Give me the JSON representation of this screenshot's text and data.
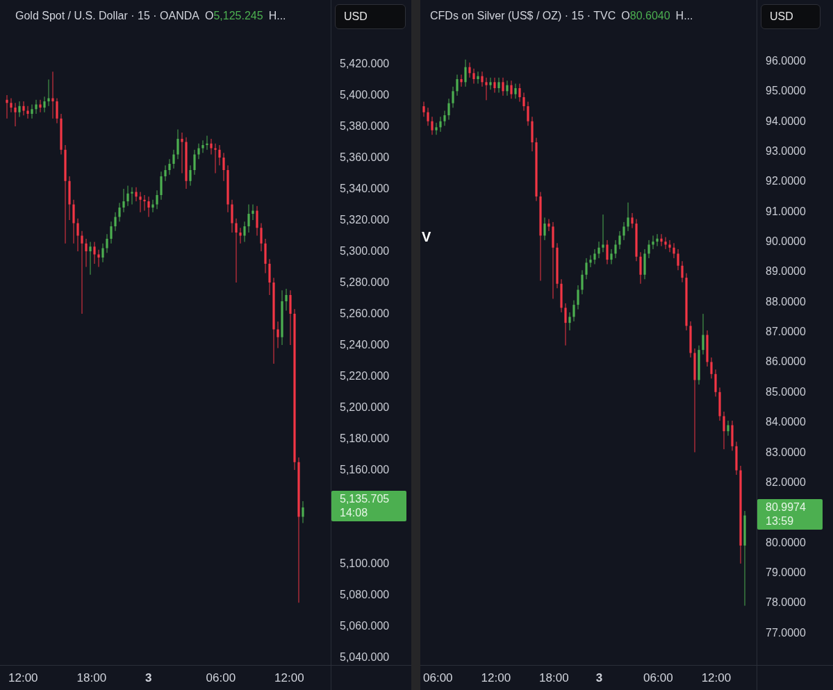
{
  "charts": [
    {
      "title": "Gold Spot / U.S. Dollar · 15 · OANDA",
      "open_label": "O",
      "open_value": "5,125.245",
      "more": "H...",
      "currency": "USD",
      "last_price": {
        "price": "5,135.705",
        "countdown": "14:08"
      },
      "time_labels": [
        {
          "kind": "time",
          "text": "12:00"
        },
        {
          "kind": "time",
          "text": "18:00"
        },
        {
          "kind": "day",
          "text": "3"
        },
        {
          "kind": "time",
          "text": "06:00"
        },
        {
          "kind": "time",
          "text": "12:00"
        }
      ],
      "chart_data": {
        "type": "candlestick",
        "categories": [
          null,
          null,
          null,
          null,
          null,
          null,
          null,
          null,
          null,
          null,
          null,
          null,
          null,
          null,
          null,
          null,
          null,
          null,
          null,
          null,
          null,
          null,
          null,
          null,
          null,
          null,
          null,
          null,
          null,
          null,
          null,
          null,
          null,
          null,
          null,
          null,
          null,
          null,
          null,
          null,
          null,
          null,
          null,
          null,
          null,
          null,
          null,
          null,
          null,
          null,
          null,
          null,
          null,
          null,
          null,
          null,
          null,
          null,
          null,
          null,
          null,
          null,
          null,
          null,
          null,
          null,
          null,
          null,
          null,
          null,
          null,
          null
        ],
        "ylim": [
          5035.1,
          5460.9
        ],
        "yticks": [
          {
            "value": 5420,
            "label": "5,420.000"
          },
          {
            "value": 5400,
            "label": "5,400.000"
          },
          {
            "value": 5380,
            "label": "5,380.000"
          },
          {
            "value": 5360,
            "label": "5,360.000"
          },
          {
            "value": 5340,
            "label": "5,340.000"
          },
          {
            "value": 5320,
            "label": "5,320.000"
          },
          {
            "value": 5300,
            "label": "5,300.000"
          },
          {
            "value": 5280,
            "label": "5,280.000"
          },
          {
            "value": 5260,
            "label": "5,260.000"
          },
          {
            "value": 5240,
            "label": "5,240.000"
          },
          {
            "value": 5220,
            "label": "5,220.000"
          },
          {
            "value": 5200,
            "label": "5,200.000"
          },
          {
            "value": 5180,
            "label": "5,180.000"
          },
          {
            "value": 5160,
            "label": "5,160.000"
          },
          {
            "value": 5100,
            "label": "5,100.000"
          },
          {
            "value": 5080,
            "label": "5,080.000"
          },
          {
            "value": 5060,
            "label": "5,060.000"
          },
          {
            "value": 5040,
            "label": "5,040.000"
          }
        ],
        "ohlc": [
          [
            5397,
            5400,
            5385,
            5395
          ],
          [
            5395,
            5398,
            5389,
            5392
          ],
          [
            5392,
            5395,
            5380,
            5389
          ],
          [
            5389,
            5396,
            5386,
            5393
          ],
          [
            5393,
            5396,
            5387,
            5390
          ],
          [
            5390,
            5393,
            5385,
            5388
          ],
          [
            5388,
            5394,
            5385,
            5391
          ],
          [
            5391,
            5397,
            5388,
            5394
          ],
          [
            5394,
            5397,
            5389,
            5392
          ],
          [
            5392,
            5399,
            5389,
            5396
          ],
          [
            5396,
            5410,
            5393,
            5398
          ],
          [
            5398,
            5415,
            5385,
            5396
          ],
          [
            5396,
            5398,
            5382,
            5385
          ],
          [
            5385,
            5388,
            5362,
            5365
          ],
          [
            5365,
            5368,
            5305,
            5345
          ],
          [
            5345,
            5348,
            5320,
            5330
          ],
          [
            5330,
            5333,
            5305,
            5318
          ],
          [
            5318,
            5321,
            5300,
            5310
          ],
          [
            5310,
            5313,
            5260,
            5305
          ],
          [
            5305,
            5308,
            5290,
            5300
          ],
          [
            5300,
            5306,
            5285,
            5303
          ],
          [
            5303,
            5306,
            5292,
            5298
          ],
          [
            5298,
            5301,
            5290,
            5296
          ],
          [
            5296,
            5305,
            5293,
            5302
          ],
          [
            5302,
            5311,
            5299,
            5308
          ],
          [
            5308,
            5319,
            5305,
            5316
          ],
          [
            5316,
            5325,
            5313,
            5322
          ],
          [
            5322,
            5331,
            5319,
            5328
          ],
          [
            5328,
            5340,
            5325,
            5332
          ],
          [
            5332,
            5342,
            5329,
            5337
          ],
          [
            5337,
            5341,
            5330,
            5338
          ],
          [
            5338,
            5341,
            5332,
            5335
          ],
          [
            5335,
            5338,
            5325,
            5333
          ],
          [
            5333,
            5336,
            5326,
            5332
          ],
          [
            5332,
            5335,
            5322,
            5328
          ],
          [
            5328,
            5333,
            5325,
            5330
          ],
          [
            5330,
            5339,
            5327,
            5336
          ],
          [
            5336,
            5351,
            5333,
            5348
          ],
          [
            5348,
            5355,
            5345,
            5352
          ],
          [
            5352,
            5359,
            5349,
            5356
          ],
          [
            5356,
            5365,
            5353,
            5362
          ],
          [
            5362,
            5378,
            5359,
            5372
          ],
          [
            5372,
            5376,
            5350,
            5370
          ],
          [
            5370,
            5373,
            5340,
            5345
          ],
          [
            5345,
            5355,
            5342,
            5352
          ],
          [
            5352,
            5365,
            5349,
            5362
          ],
          [
            5362,
            5369,
            5359,
            5366
          ],
          [
            5366,
            5371,
            5363,
            5368
          ],
          [
            5368,
            5374,
            5365,
            5369
          ],
          [
            5369,
            5372,
            5362,
            5366
          ],
          [
            5366,
            5369,
            5350,
            5365
          ],
          [
            5365,
            5368,
            5355,
            5360
          ],
          [
            5360,
            5363,
            5345,
            5352
          ],
          [
            5352,
            5355,
            5325,
            5330
          ],
          [
            5330,
            5333,
            5312,
            5318
          ],
          [
            5318,
            5321,
            5280,
            5312
          ],
          [
            5312,
            5315,
            5305,
            5310
          ],
          [
            5310,
            5319,
            5306,
            5316
          ],
          [
            5316,
            5330,
            5312,
            5324
          ],
          [
            5324,
            5330,
            5320,
            5326
          ],
          [
            5326,
            5329,
            5310,
            5315
          ],
          [
            5315,
            5318,
            5300,
            5305
          ],
          [
            5305,
            5308,
            5286,
            5292
          ],
          [
            5292,
            5295,
            5272,
            5280
          ],
          [
            5280,
            5283,
            5228,
            5250
          ],
          [
            5250,
            5255,
            5238,
            5245
          ],
          [
            5245,
            5275,
            5240,
            5268
          ],
          [
            5268,
            5276,
            5262,
            5272
          ],
          [
            5272,
            5275,
            5240,
            5260
          ],
          [
            5260,
            5263,
            5160,
            5165
          ],
          [
            5165,
            5168,
            5075,
            5130
          ],
          [
            5130,
            5140,
            5126,
            5136
          ]
        ]
      }
    },
    {
      "title": "CFDs on Silver (US$ / OZ) · 15 · TVC",
      "open_label": "O",
      "open_value": "80.6040",
      "more": "H...",
      "currency": "USD",
      "side_mark": "V",
      "last_price": {
        "price": "80.9974",
        "countdown": "13:59"
      },
      "time_labels": [
        {
          "kind": "time",
          "text": "06:00"
        },
        {
          "kind": "time",
          "text": "12:00"
        },
        {
          "kind": "time",
          "text": "18:00"
        },
        {
          "kind": "day",
          "text": "3"
        },
        {
          "kind": "time",
          "text": "06:00"
        },
        {
          "kind": "time",
          "text": "12:00"
        }
      ],
      "chart_data": {
        "type": "candlestick",
        "categories": [
          null,
          null,
          null,
          null,
          null,
          null,
          null,
          null,
          null,
          null,
          null,
          null,
          null,
          null,
          null,
          null,
          null,
          null,
          null,
          null,
          null,
          null,
          null,
          null,
          null,
          null,
          null,
          null,
          null,
          null,
          null,
          null,
          null,
          null,
          null,
          null,
          null,
          null,
          null,
          null,
          null,
          null,
          null,
          null,
          null,
          null,
          null,
          null,
          null,
          null,
          null,
          null,
          null,
          null,
          null,
          null,
          null,
          null,
          null,
          null,
          null,
          null,
          null,
          null,
          null,
          null,
          null,
          null,
          null,
          null,
          null,
          null,
          null,
          null,
          null,
          null,
          null,
          null
        ],
        "ylim": [
          75.93,
          98.03
        ],
        "yticks": [
          {
            "value": 96,
            "label": "96.0000"
          },
          {
            "value": 95,
            "label": "95.0000"
          },
          {
            "value": 94,
            "label": "94.0000"
          },
          {
            "value": 93,
            "label": "93.0000"
          },
          {
            "value": 92,
            "label": "92.0000"
          },
          {
            "value": 91,
            "label": "91.0000"
          },
          {
            "value": 90,
            "label": "90.0000"
          },
          {
            "value": 89,
            "label": "89.0000"
          },
          {
            "value": 88,
            "label": "88.0000"
          },
          {
            "value": 87,
            "label": "87.0000"
          },
          {
            "value": 86,
            "label": "86.0000"
          },
          {
            "value": 85,
            "label": "85.0000"
          },
          {
            "value": 84,
            "label": "84.0000"
          },
          {
            "value": 83,
            "label": "83.0000"
          },
          {
            "value": 82,
            "label": "82.0000"
          },
          {
            "value": 80,
            "label": "80.0000"
          },
          {
            "value": 79,
            "label": "79.0000"
          },
          {
            "value": 78,
            "label": "78.0000"
          },
          {
            "value": 77,
            "label": "77.0000"
          }
        ],
        "ohlc": [
          [
            94.5,
            94.65,
            94.15,
            94.3
          ],
          [
            94.3,
            94.45,
            93.85,
            94.0
          ],
          [
            94.0,
            94.15,
            93.55,
            93.7
          ],
          [
            93.7,
            93.95,
            93.55,
            93.8
          ],
          [
            93.8,
            94.15,
            93.65,
            94.0
          ],
          [
            94.0,
            94.35,
            93.85,
            94.2
          ],
          [
            94.2,
            94.75,
            94.05,
            94.6
          ],
          [
            94.6,
            95.15,
            94.45,
            95.0
          ],
          [
            95.0,
            95.55,
            94.85,
            95.4
          ],
          [
            95.4,
            95.55,
            95.15,
            95.3
          ],
          [
            95.3,
            96.05,
            95.15,
            95.8
          ],
          [
            95.8,
            95.95,
            95.45,
            95.6
          ],
          [
            95.6,
            95.75,
            95.25,
            95.4
          ],
          [
            95.4,
            95.65,
            95.25,
            95.5
          ],
          [
            95.5,
            95.65,
            95.15,
            95.3
          ],
          [
            95.3,
            95.45,
            94.7,
            95.2
          ],
          [
            95.2,
            95.45,
            95.05,
            95.3
          ],
          [
            95.3,
            95.45,
            94.95,
            95.1
          ],
          [
            95.1,
            95.45,
            94.95,
            95.3
          ],
          [
            95.3,
            95.45,
            94.85,
            95.0
          ],
          [
            95.0,
            95.35,
            94.85,
            95.2
          ],
          [
            95.2,
            95.35,
            94.75,
            94.9
          ],
          [
            94.9,
            95.25,
            94.75,
            95.1
          ],
          [
            95.1,
            95.25,
            94.65,
            94.8
          ],
          [
            94.8,
            94.95,
            94.35,
            94.5
          ],
          [
            94.5,
            94.65,
            93.85,
            94.0
          ],
          [
            94.0,
            94.15,
            93.0,
            93.3
          ],
          [
            93.3,
            93.45,
            91.35,
            91.5
          ],
          [
            91.5,
            91.65,
            88.7,
            90.2
          ],
          [
            90.2,
            90.8,
            90.05,
            90.6
          ],
          [
            90.6,
            90.75,
            90.35,
            90.5
          ],
          [
            90.5,
            90.65,
            88.1,
            89.8
          ],
          [
            89.8,
            89.95,
            88.45,
            88.6
          ],
          [
            88.6,
            88.75,
            87.65,
            87.8
          ],
          [
            87.8,
            87.95,
            86.55,
            87.3
          ],
          [
            87.3,
            87.65,
            87.05,
            87.5
          ],
          [
            87.5,
            88.05,
            87.35,
            87.9
          ],
          [
            87.9,
            88.55,
            87.75,
            88.4
          ],
          [
            88.4,
            89.05,
            88.25,
            88.9
          ],
          [
            88.9,
            89.45,
            88.75,
            89.3
          ],
          [
            89.3,
            89.55,
            89.15,
            89.4
          ],
          [
            89.4,
            89.75,
            89.25,
            89.6
          ],
          [
            89.6,
            90.0,
            89.45,
            89.8
          ],
          [
            89.8,
            90.9,
            89.65,
            89.9
          ],
          [
            89.9,
            90.05,
            89.25,
            89.4
          ],
          [
            89.4,
            89.75,
            89.25,
            89.6
          ],
          [
            89.6,
            90.05,
            89.45,
            89.9
          ],
          [
            89.9,
            90.35,
            89.75,
            90.2
          ],
          [
            90.2,
            90.65,
            90.05,
            90.5
          ],
          [
            90.5,
            91.3,
            90.35,
            90.8
          ],
          [
            90.8,
            90.95,
            90.45,
            90.6
          ],
          [
            90.6,
            90.75,
            89.35,
            89.5
          ],
          [
            89.5,
            89.65,
            88.6,
            88.9
          ],
          [
            88.9,
            89.75,
            88.75,
            89.6
          ],
          [
            89.6,
            90.05,
            89.45,
            89.9
          ],
          [
            89.9,
            90.2,
            89.75,
            90.0
          ],
          [
            90.0,
            90.25,
            89.85,
            90.1
          ],
          [
            90.1,
            90.25,
            89.85,
            90.0
          ],
          [
            90.0,
            90.15,
            89.75,
            89.9
          ],
          [
            89.9,
            90.05,
            89.65,
            89.8
          ],
          [
            89.8,
            89.95,
            89.45,
            89.6
          ],
          [
            89.6,
            89.75,
            89.05,
            89.2
          ],
          [
            89.2,
            89.35,
            88.65,
            88.8
          ],
          [
            88.8,
            88.95,
            87.05,
            87.2
          ],
          [
            87.2,
            87.35,
            86.15,
            86.3
          ],
          [
            86.3,
            86.45,
            83.0,
            85.4
          ],
          [
            85.4,
            86.55,
            85.25,
            86.4
          ],
          [
            86.4,
            87.6,
            86.25,
            86.9
          ],
          [
            86.9,
            87.05,
            85.85,
            86.0
          ],
          [
            86.0,
            86.15,
            85.45,
            85.6
          ],
          [
            85.6,
            85.75,
            84.85,
            85.0
          ],
          [
            85.0,
            85.15,
            84.05,
            84.2
          ],
          [
            84.2,
            84.35,
            83.1,
            83.7
          ],
          [
            83.7,
            84.05,
            83.55,
            83.9
          ],
          [
            83.9,
            84.05,
            83.05,
            83.2
          ],
          [
            83.2,
            83.35,
            82.25,
            82.4
          ],
          [
            82.4,
            82.55,
            79.3,
            79.9
          ],
          [
            79.9,
            81.05,
            77.9,
            80.9
          ]
        ]
      }
    }
  ]
}
